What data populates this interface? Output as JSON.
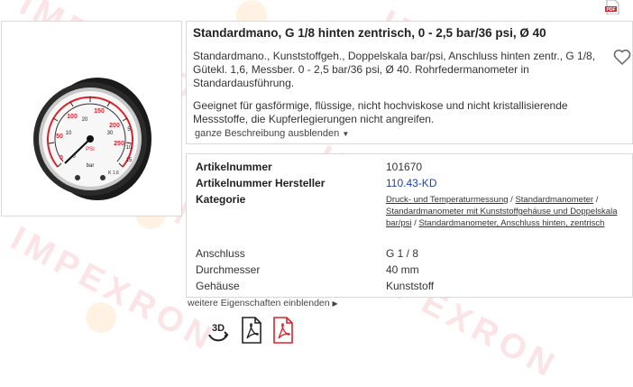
{
  "product": {
    "title": "Standardmano, G 1/8 hinten zentrisch, 0 - 2,5 bar/36 psi, Ø 40",
    "description_1": "Standardmano., Kunststoffgeh., Doppelskala bar/psi, Anschluss hinten zentr., G 1/8, Gütekl. 1,6, Messber. 0 - 2,5 bar/36 psi, Ø 40. Rohrfedermanometer in Standardausführung.",
    "description_2": "Geeignet für gasförmige, flüssige, nicht hochviskose und nicht kristallisierende Messstoffe, die Kupferlegierungen nicht angreifen.",
    "collapse_label": "ganze Beschreibung ausblenden",
    "image_alt": "Manometer",
    "gauge": {
      "psi_ticks": [
        "0",
        "10",
        "20",
        "30"
      ],
      "bar_ticks": [
        "0",
        "50",
        "100",
        "150",
        "200",
        "250"
      ],
      "outer_ticks": [
        "5",
        "10",
        "15"
      ],
      "unit_psi": "PSI",
      "unit_bar": "bar",
      "class_label": "K 1.6"
    }
  },
  "attributes": {
    "artikelnummer_label": "Artikelnummer",
    "artikelnummer_value": "101670",
    "hersteller_label": "Artikelnummer Hersteller",
    "hersteller_value": "110.43-KD",
    "kategorie_label": "Kategorie",
    "kategorie_links": [
      "Druck- und Temperaturmessung",
      "Standardmanometer",
      "Standardmanometer mit Kunststoffgehäuse und Doppelskala bar/psi",
      "Standardmanometer, Anschluss hinten, zentrisch"
    ],
    "kategorie_sep": " / ",
    "anschluss_label": "Anschluss",
    "anschluss_value": "G 1 / 8",
    "durchmesser_label": "Durchmesser",
    "durchmesser_value": "40 mm",
    "gehaeuse_label": "Gehäuse",
    "gehaeuse_value": "Kunststoff"
  },
  "more_label": "weitere Eigenschaften einblenden",
  "icons": {
    "three_d_label": "3D",
    "pdf_top": "pdf-icon",
    "favorite": "heart-icon",
    "pdf_datasheet": "pdf-outline-icon",
    "pdf_document": "pdf-red-icon"
  },
  "watermark": "IMPEXRON",
  "colors": {
    "accent_red": "#d9232e",
    "link_blue": "#1a44b8",
    "border": "#d9d9d9"
  }
}
